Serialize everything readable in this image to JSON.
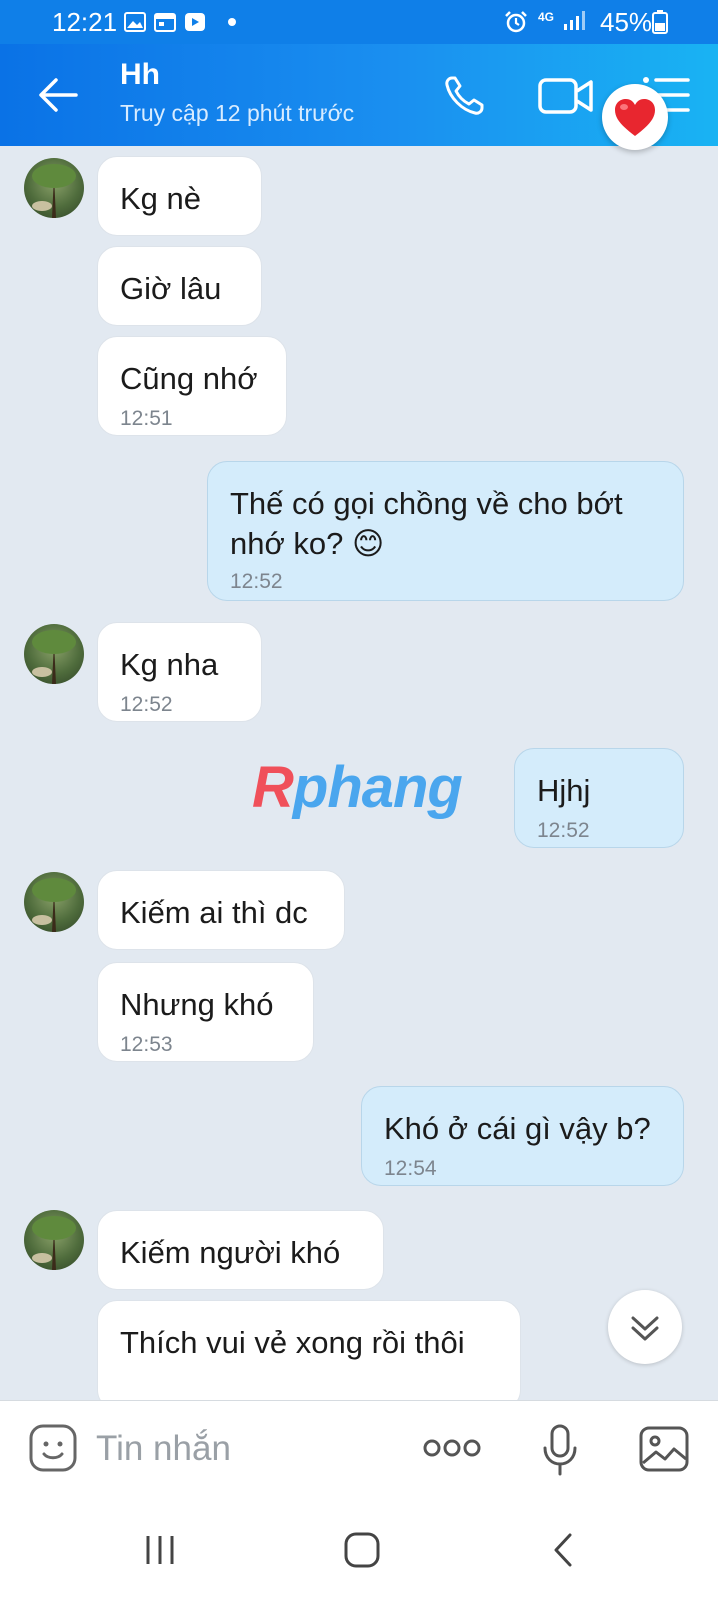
{
  "status_bar": {
    "time": "12:21",
    "network": "4G",
    "battery": "45%",
    "icons": [
      "gallery-icon",
      "calendar-icon",
      "cast-icon",
      "alarm-icon",
      "signal-icon",
      "battery-icon"
    ]
  },
  "header": {
    "name": "Hh",
    "status": "Truy cập 12 phút trước",
    "icons": [
      "back-arrow-icon",
      "phone-icon",
      "video-call-icon",
      "menu-icon",
      "heart-icon"
    ],
    "accent_color": "#0f7fe8"
  },
  "messages": [
    {
      "side": "in",
      "text": "Kg nè",
      "time": ""
    },
    {
      "side": "in",
      "text": "Giờ lâu",
      "time": ""
    },
    {
      "side": "in",
      "text": "Cũng nhớ",
      "time": "12:51"
    },
    {
      "side": "out",
      "lines": [
        "Thế có gọi chồng về cho bớt",
        "nhớ ko? 😊"
      ],
      "time": "12:52"
    },
    {
      "side": "in",
      "text": "Kg nha",
      "time": "12:52"
    },
    {
      "side": "out",
      "text": "Hjhj",
      "time": "12:52"
    },
    {
      "side": "in",
      "text": "Kiếm ai thì dc",
      "time": ""
    },
    {
      "side": "in",
      "text": "Nhưng khó",
      "time": "12:53"
    },
    {
      "side": "out",
      "text": "Khó ở cái gì vậy b?",
      "time": "12:54"
    },
    {
      "side": "in",
      "text": "Kiếm người khó",
      "time": ""
    },
    {
      "side": "in",
      "text": "Thích vui vẻ xong rồi thôi",
      "time": ""
    }
  ],
  "watermark": {
    "part1": "R",
    "part2": "phang"
  },
  "input_bar": {
    "placeholder": "Tin nhắn",
    "icons": [
      "emoji-icon",
      "more-icon",
      "microphone-icon",
      "image-icon"
    ]
  },
  "nav_bar": {
    "icons": [
      "recent-apps-icon",
      "home-icon",
      "back-icon"
    ]
  }
}
